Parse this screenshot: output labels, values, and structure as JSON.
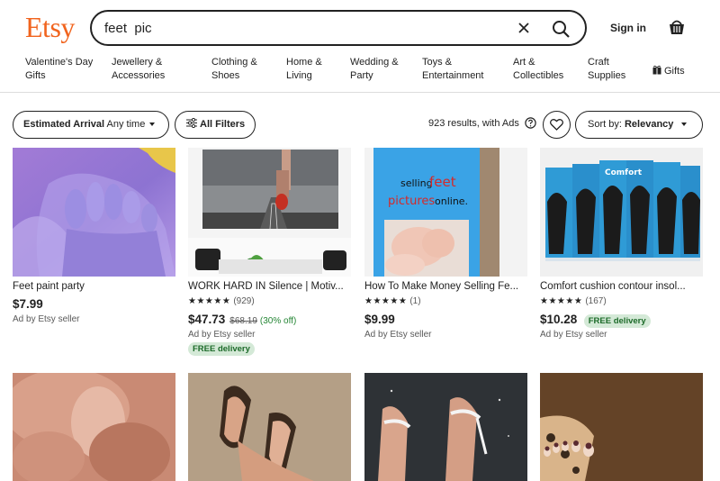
{
  "header": {
    "logo": "Etsy",
    "search_value": "feet  pic",
    "signin_label": "Sign in"
  },
  "nav": {
    "items": [
      {
        "line1": "Valentine's Day",
        "line2": "Gifts"
      },
      {
        "line1": "Jewellery &",
        "line2": "Accessories"
      },
      {
        "line1": "Clothing &",
        "line2": "Shoes"
      },
      {
        "line1": "Home &",
        "line2": "Living"
      },
      {
        "line1": "Wedding &",
        "line2": "Party"
      },
      {
        "line1": "Toys &",
        "line2": "Entertainment"
      },
      {
        "line1": "Art &",
        "line2": "Collectibles"
      },
      {
        "line1": "Craft",
        "line2": "Supplies"
      },
      {
        "line1": "Gifts",
        "line2": ""
      }
    ]
  },
  "filters": {
    "estimated_arrival_label": "Estimated Arrival",
    "estimated_arrival_value": "Any time",
    "all_filters_label": "All Filters",
    "results_text": "923 results, with Ads",
    "sort_label": "Sort by:",
    "sort_value": "Relevancy"
  },
  "products": [
    {
      "title": "Feet paint party",
      "price": "$7.99",
      "seller": "Ad by Etsy seller"
    },
    {
      "title": "WORK HARD IN Silence | Motiv...",
      "stars": "★★★★★",
      "reviews": "(929)",
      "price": "$47.73",
      "old_price": "$68.19",
      "discount": "(30% off)",
      "seller": "Ad by Etsy seller",
      "badge": "FREE delivery"
    },
    {
      "title": "How To Make Money Selling Fe...",
      "stars": "★★★★★",
      "reviews": "(1)",
      "price": "$9.99",
      "seller": "Ad by Etsy seller",
      "cover_text": [
        "selling",
        "feet",
        "pictures",
        "online."
      ]
    },
    {
      "title": "Comfort cushion contour insol...",
      "stars": "★★★★★",
      "reviews": "(167)",
      "price": "$10.28",
      "badge": "FREE delivery",
      "seller": "Ad by Etsy seller",
      "package_text": "Comfort"
    }
  ]
}
